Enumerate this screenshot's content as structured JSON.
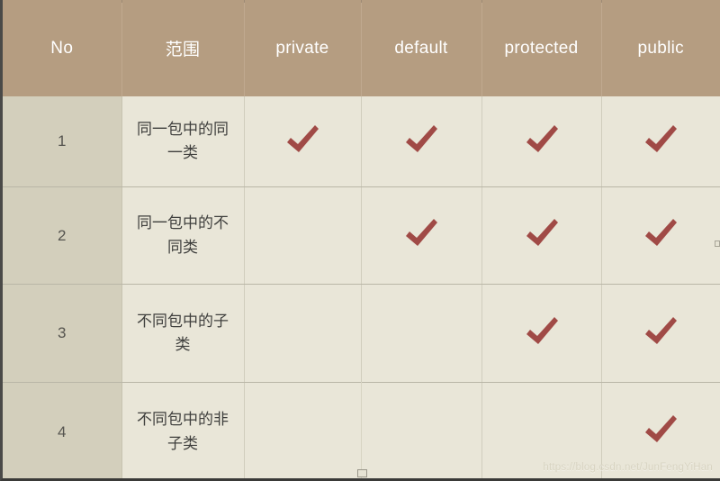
{
  "table": {
    "columns": [
      {
        "key": "no",
        "label": "No",
        "cjk": false
      },
      {
        "key": "scope",
        "label": "范围",
        "cjk": true
      },
      {
        "key": "private",
        "label": "private",
        "cjk": false
      },
      {
        "key": "default",
        "label": "default",
        "cjk": false
      },
      {
        "key": "protected",
        "label": "protected",
        "cjk": false
      },
      {
        "key": "public",
        "label": "public",
        "cjk": false
      }
    ],
    "rows": [
      {
        "no": "1",
        "scope": "同一包中的同一类",
        "private": "check",
        "default": "check",
        "protected": "check",
        "public": "check"
      },
      {
        "no": "2",
        "scope": "同一包中的不同类",
        "private": "",
        "default": "check",
        "protected": "check",
        "public": "check"
      },
      {
        "no": "3",
        "scope": "不同包中的子类",
        "private": "",
        "default": "",
        "protected": "check",
        "public": "check"
      },
      {
        "no": "4",
        "scope": "不同包中的非子类",
        "private": "",
        "default": "",
        "protected": "",
        "public": "check"
      }
    ]
  },
  "icons": {
    "check": "check-icon"
  },
  "watermark": {
    "text": "https://blog.csdn.net/JunFengYiHan"
  },
  "colors": {
    "header_background": "#b59d81",
    "header_text": "#ffffff",
    "no_column_background": "#d3cfbc",
    "body_background": "#e9e6d8",
    "check_mark": "#a04a46",
    "grid_line": "#b9b6a7",
    "body_text": "#3f3f3d"
  }
}
